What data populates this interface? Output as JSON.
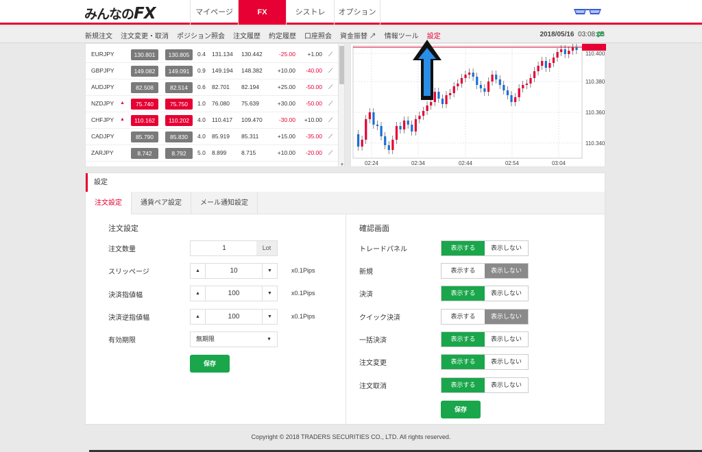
{
  "brand": {
    "logo_prefix": "みんなの",
    "logo_suffix": "FX"
  },
  "top_nav": [
    {
      "label": "マイページ",
      "active": false
    },
    {
      "label": "FX",
      "active": true
    },
    {
      "label": "シストレ",
      "active": false
    },
    {
      "label": "オプション",
      "active": false
    }
  ],
  "sub_nav": [
    {
      "label": "新規注文"
    },
    {
      "label": "注文変更・取消"
    },
    {
      "label": "ポジション照会"
    },
    {
      "label": "注文履歴"
    },
    {
      "label": "約定履歴"
    },
    {
      "label": "口座照会"
    },
    {
      "label": "資金振替 ↗"
    },
    {
      "label": "情報ツール"
    },
    {
      "label": "設定",
      "active": true
    }
  ],
  "datetime": {
    "date": "2018/05/16",
    "time": "03:08:03"
  },
  "rates": [
    {
      "pair": "EURJPY",
      "up": false,
      "bid": "130.801",
      "ask": "130.805",
      "bid_red": false,
      "ask_red": false,
      "spread": "0.4",
      "high": "131.134",
      "low": "130.442",
      "c1": "-25.00",
      "c2": "+1.00"
    },
    {
      "pair": "GBPJPY",
      "up": false,
      "bid": "149.082",
      "ask": "149.091",
      "bid_red": false,
      "ask_red": false,
      "spread": "0.9",
      "high": "149.194",
      "low": "148.382",
      "c1": "+10.00",
      "c2": "-40.00"
    },
    {
      "pair": "AUDJPY",
      "up": false,
      "bid": "82.508",
      "ask": "82.514",
      "bid_red": false,
      "ask_red": false,
      "spread": "0.6",
      "high": "82.701",
      "low": "82.194",
      "c1": "+25.00",
      "c2": "-50.00"
    },
    {
      "pair": "NZDJPY",
      "up": true,
      "bid": "75.740",
      "ask": "75.750",
      "bid_red": true,
      "ask_red": true,
      "spread": "1.0",
      "high": "76.080",
      "low": "75.639",
      "c1": "+30.00",
      "c2": "-50.00"
    },
    {
      "pair": "CHFJPY",
      "up": true,
      "bid": "110.162",
      "ask": "110.202",
      "bid_red": true,
      "ask_red": true,
      "spread": "4.0",
      "high": "110.417",
      "low": "109.470",
      "c1": "-30.00",
      "c2": "+10.00"
    },
    {
      "pair": "CADJPY",
      "up": false,
      "bid": "85.790",
      "ask": "85.830",
      "bid_red": false,
      "ask_red": false,
      "spread": "4.0",
      "high": "85.919",
      "low": "85.311",
      "c1": "+15.00",
      "c2": "-35.00"
    },
    {
      "pair": "ZARJPY",
      "up": false,
      "bid": "8.742",
      "ask": "8.792",
      "bid_red": false,
      "ask_red": false,
      "spread": "5.0",
      "high": "8.899",
      "low": "8.715",
      "c1": "+10.00",
      "c2": "-20.00"
    }
  ],
  "chart": {
    "y_ticks": [
      "110.400",
      "110.380",
      "110.360",
      "110.340"
    ],
    "x_ticks": [
      "02:24",
      "02:34",
      "02:44",
      "02:54",
      "03:04"
    ],
    "colors": {
      "up": "#e60033",
      "down": "#1a6fd4"
    }
  },
  "settings": {
    "header": "設定",
    "tabs": [
      {
        "label": "注文設定",
        "active": true
      },
      {
        "label": "通貨ペア設定",
        "active": false
      },
      {
        "label": "メール通知設定",
        "active": false
      }
    ],
    "order": {
      "title": "注文設定",
      "qty_label": "注文数量",
      "qty_value": "1",
      "qty_unit": "Lot",
      "slip_label": "スリッページ",
      "slip_value": "10",
      "slip_unit": "x0.1Pips",
      "limit_label": "決済指値幅",
      "limit_value": "100",
      "limit_unit": "x0.1Pips",
      "stop_label": "決済逆指値幅",
      "stop_value": "100",
      "stop_unit": "x0.1Pips",
      "expiry_label": "有効期限",
      "expiry_value": "無期限",
      "save": "保存"
    },
    "confirm": {
      "title": "確認画面",
      "show": "表示する",
      "hide": "表示しない",
      "items": [
        {
          "label": "トレードパネル",
          "state": "show"
        },
        {
          "label": "新規",
          "state": "hide"
        },
        {
          "label": "決済",
          "state": "show"
        },
        {
          "label": "クイック決済",
          "state": "hide"
        },
        {
          "label": "一括決済",
          "state": "show"
        },
        {
          "label": "注文変更",
          "state": "show"
        },
        {
          "label": "注文取消",
          "state": "show"
        }
      ],
      "save": "保存"
    }
  },
  "footer": "Copyright © 2018 TRADERS SECURITIES CO., LTD. All rights reserved."
}
